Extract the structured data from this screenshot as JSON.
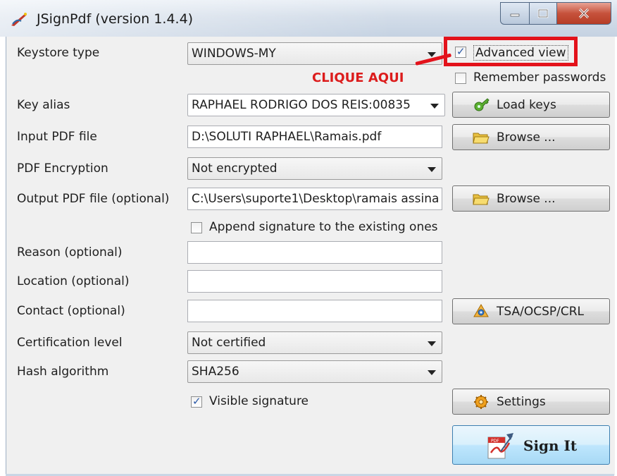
{
  "window": {
    "title": "JSignPdf (version 1.4.4)",
    "app_icon": "jsignpdf-icon",
    "controls": [
      "minimize-icon",
      "maximize-icon",
      "close-icon"
    ]
  },
  "form": {
    "keystore_type": {
      "label": "Keystore type",
      "value": "WINDOWS-MY"
    },
    "key_alias": {
      "label": "Key alias",
      "value": "RAPHAEL RODRIGO DOS REIS:00835"
    },
    "input_pdf": {
      "label": "Input PDF file",
      "value": "D:\\SOLUTI RAPHAEL\\Ramais.pdf"
    },
    "pdf_encryption": {
      "label": "PDF Encryption",
      "value": "Not encrypted"
    },
    "output_pdf": {
      "label": "Output PDF file (optional)",
      "value": "C:\\Users\\suporte1\\Desktop\\ramais assina"
    },
    "append_signature": {
      "label": "Append signature to the existing ones",
      "checked": false
    },
    "reason": {
      "label": "Reason (optional)",
      "value": ""
    },
    "location": {
      "label": "Location (optional)",
      "value": ""
    },
    "contact": {
      "label": "Contact (optional)",
      "value": ""
    },
    "certification_level": {
      "label": "Certification level",
      "value": "Not certified"
    },
    "hash_algorithm": {
      "label": "Hash algorithm",
      "value": "SHA256"
    },
    "visible_signature": {
      "label": "Visible signature",
      "checked": true
    }
  },
  "options": {
    "advanced_view": {
      "label": "Advanced view",
      "checked": true
    },
    "remember_passwords": {
      "label": "Remember passwords",
      "checked": false
    }
  },
  "buttons": {
    "load_keys": "Load keys",
    "browse_input": "Browse ...",
    "browse_output": "Browse ...",
    "tsa": "TSA/OCSP/CRL",
    "settings": "Settings",
    "sign_it": "Sign It"
  },
  "annotation": {
    "text": "CLIQUE AQUI",
    "color": "#e3121b"
  }
}
